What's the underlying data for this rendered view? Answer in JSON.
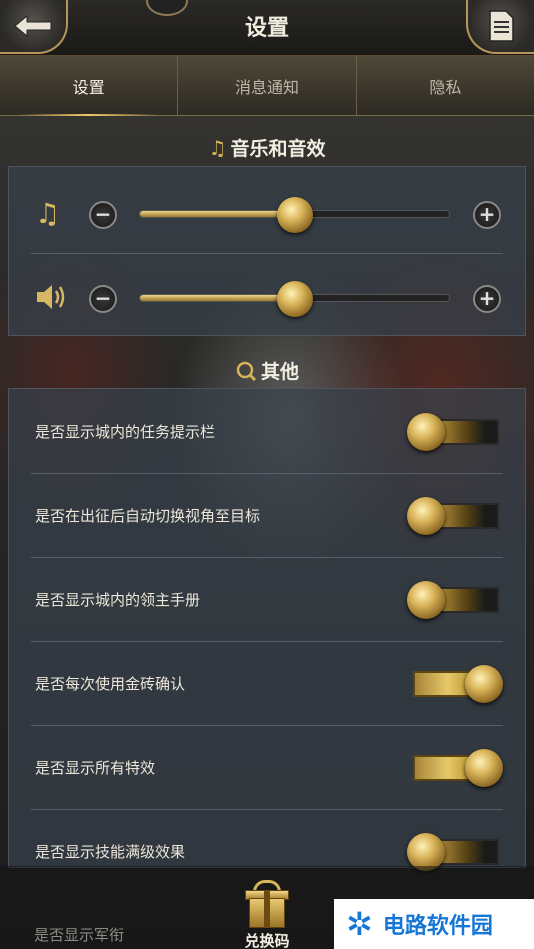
{
  "header": {
    "title": "设置",
    "back_icon": "back-arrow-icon",
    "doc_icon": "document-icon"
  },
  "tabs": [
    {
      "label": "设置",
      "active": true
    },
    {
      "label": "消息通知",
      "active": false
    },
    {
      "label": "隐私",
      "active": false
    }
  ],
  "audio_section": {
    "title": "音乐和音效",
    "icon": "music-note-icon",
    "sliders": [
      {
        "name": "music",
        "icon": "music-note-icon",
        "value": 0.5
      },
      {
        "name": "sound-effects",
        "icon": "speaker-icon",
        "value": 0.5
      }
    ]
  },
  "other_section": {
    "title": "其他",
    "icon": "magnifier-icon",
    "toggles": [
      {
        "label": "是否显示城内的任务提示栏",
        "on": false
      },
      {
        "label": "是否在出征后自动切换视角至目标",
        "on": false
      },
      {
        "label": "是否显示城内的领主手册",
        "on": false
      },
      {
        "label": "是否每次使用金砖确认",
        "on": true
      },
      {
        "label": "是否显示所有特效",
        "on": true
      },
      {
        "label": "是否显示技能满级效果",
        "on": false
      }
    ],
    "partial_row_label": "是否显示军衔"
  },
  "bottom": {
    "gift_label": "兑换码",
    "gift_icon": "gift-box-icon"
  },
  "watermark": {
    "text": "电路软件园",
    "logo_icon": "snowflake-logo-icon"
  },
  "colors": {
    "accent_gold": "#d9b45a",
    "panel_bg": "#37414b",
    "watermark_blue": "#1676d6"
  }
}
